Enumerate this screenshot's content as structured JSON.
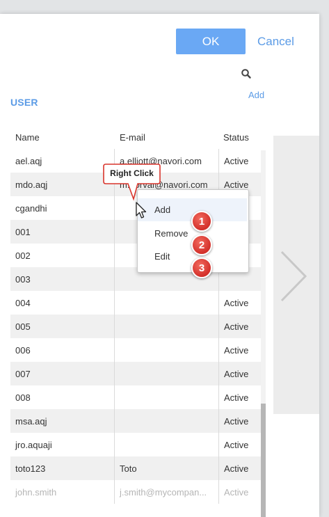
{
  "header": {
    "ok_label": "OK",
    "cancel_label": "Cancel",
    "add_label": "Add",
    "search_icon": "search-icon"
  },
  "section": {
    "title": "USER"
  },
  "table": {
    "columns": [
      "Name",
      "E-mail",
      "Status"
    ],
    "rows": [
      {
        "name": "ael.aqj",
        "email": "a.elliott@navori.com",
        "status": "Active"
      },
      {
        "name": "mdo.aqj",
        "email": "m.dorval@navori.com",
        "status": "Active"
      },
      {
        "name": "cgandhi",
        "email": "",
        "status": ""
      },
      {
        "name": "001",
        "email": "",
        "status": ""
      },
      {
        "name": "002",
        "email": "",
        "status": ""
      },
      {
        "name": "003",
        "email": "",
        "status": ""
      },
      {
        "name": "004",
        "email": "",
        "status": "Active"
      },
      {
        "name": "005",
        "email": "",
        "status": "Active"
      },
      {
        "name": "006",
        "email": "",
        "status": "Active"
      },
      {
        "name": "007",
        "email": "",
        "status": "Active"
      },
      {
        "name": "008",
        "email": "",
        "status": "Active"
      },
      {
        "name": "msa.aqj",
        "email": "",
        "status": "Active"
      },
      {
        "name": "jro.aquaji",
        "email": "",
        "status": "Active"
      },
      {
        "name": "toto123",
        "email": "Toto",
        "status": "Active"
      },
      {
        "name": "john.smith",
        "email": "j.smith@mycompan...",
        "status": "Active"
      }
    ]
  },
  "context_menu": {
    "items": [
      {
        "label": "Add",
        "badge": "1"
      },
      {
        "label": "Remove",
        "badge": "2"
      },
      {
        "label": "Edit",
        "badge": "3"
      }
    ]
  },
  "annotation": {
    "callout_text": "Right Click"
  },
  "colors": {
    "accent": "#5b9be6",
    "ok_button": "#6aa8f4",
    "badge": "#d9342b"
  }
}
